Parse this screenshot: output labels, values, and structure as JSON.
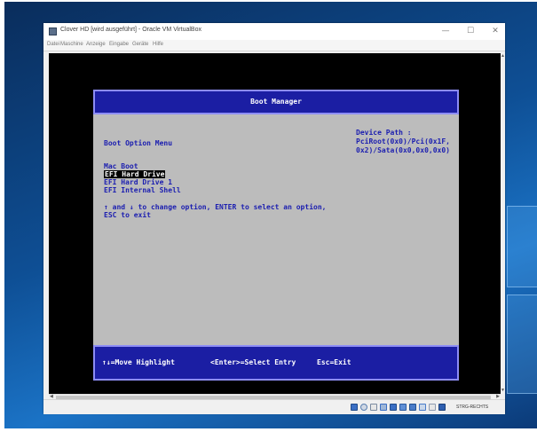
{
  "window": {
    "title": "Clover HD [wird ausgeführt] - Oracle VM VirtualBox",
    "minimize": "—",
    "maximize": "☐",
    "close": "✕"
  },
  "menubar": {
    "items": [
      "Datei",
      "Maschine",
      "Anzeige",
      "Eingabe",
      "Geräte",
      "Hilfe"
    ]
  },
  "boot_manager": {
    "title": "Boot Manager",
    "section_title": "Boot Option Menu",
    "device_path_label": "Device Path :",
    "device_path_line1": "PciRoot(0x0)/Pci(0x1F,",
    "device_path_line2": "0x2)/Sata(0x0,0x0,0x0)",
    "options": [
      "Mac Boot",
      "EFI Hard Drive",
      "EFI Hard Drive 1",
      "EFI Internal Shell"
    ],
    "selected_index": 1,
    "help_line1": "↑ and ↓ to change option, ENTER to select an option,",
    "help_line2": "ESC to exit",
    "footer": {
      "move": "↑↓=Move Highlight",
      "select": "<Enter>=Select Entry",
      "exit": "Esc=Exit"
    }
  },
  "statusbar": {
    "host_key": "STRG-RECHTS",
    "icons": [
      "hard-disk-icon",
      "optical-drive-icon",
      "audio-icon",
      "network-icon",
      "usb-icon",
      "shared-folders-icon",
      "display-icon",
      "video-capture-icon",
      "mouse-integration-icon",
      "cpu-icon"
    ]
  },
  "colors": {
    "boot_blue": "#1b1ea3",
    "boot_gray": "#bcbcbc",
    "boot_text": "#1b1eb0",
    "desktop_blue": "#0e4f95"
  }
}
